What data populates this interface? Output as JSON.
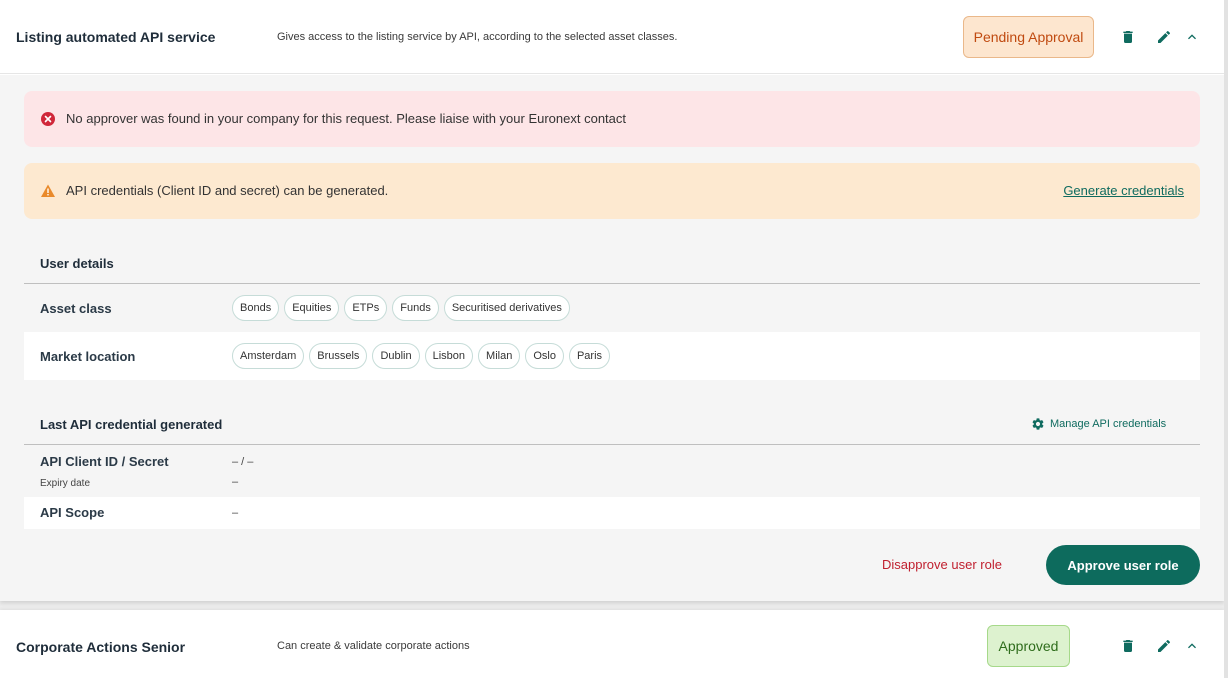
{
  "roles": [
    {
      "title": "Listing automated API service",
      "description": "Gives access to the listing service by API, according to the selected asset classes.",
      "status": "Pending Approval",
      "alerts": {
        "error": "No approver was found in your company for this request. Please liaise with your Euronext contact",
        "warning": "API credentials (Client ID and secret) can be generated.",
        "warning_link": "Generate credentials"
      },
      "user_details": {
        "title": "User details",
        "asset_class_label": "Asset class",
        "asset_classes": [
          "Bonds",
          "Equities",
          "ETPs",
          "Funds",
          "Securitised derivatives"
        ],
        "market_location_label": "Market location",
        "market_locations": [
          "Amsterdam",
          "Brussels",
          "Dublin",
          "Lisbon",
          "Milan",
          "Oslo",
          "Paris"
        ]
      },
      "credentials": {
        "title": "Last API credential generated",
        "manage_label": "Manage API credentials",
        "client_id_label": "API Client ID / Secret",
        "client_id_value": "– / –",
        "expiry_label": "Expiry date",
        "expiry_value": "–",
        "scope_label": "API Scope",
        "scope_value": "–"
      },
      "actions": {
        "disapprove": "Disapprove user role",
        "approve": "Approve user role"
      }
    },
    {
      "title": "Corporate Actions Senior",
      "description": "Can create & validate corporate actions",
      "status": "Approved"
    }
  ],
  "colors": {
    "primary": "#0d6b5d",
    "danger": "#c0202f",
    "pending_bg": "#fde6cf",
    "approved_bg": "#ddf2cf",
    "error_bg": "#fde5e7",
    "warning_bg": "#fde9d0"
  },
  "icons": [
    "trash-icon",
    "pencil-icon",
    "chevron-up-icon",
    "error-circle-icon",
    "warning-triangle-icon",
    "gear-icon"
  ]
}
